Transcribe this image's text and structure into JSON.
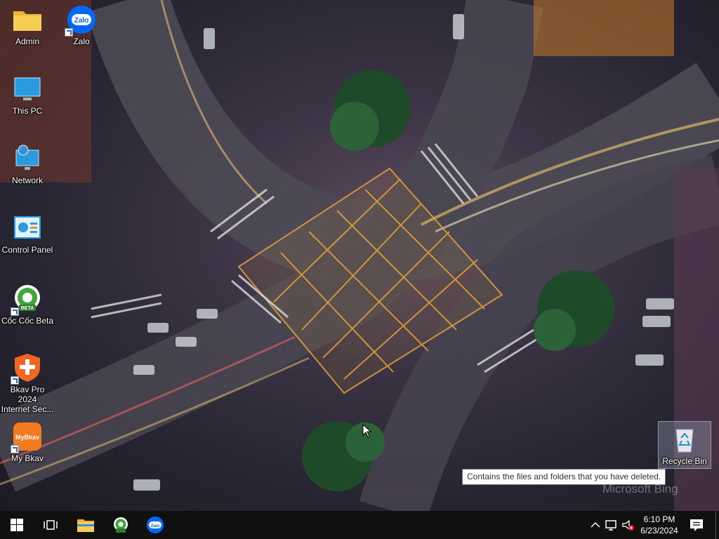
{
  "desktop": {
    "icons": [
      {
        "label": "Admin"
      },
      {
        "label": "Zalo"
      },
      {
        "label": "This PC"
      },
      {
        "label": "Network"
      },
      {
        "label": "Control Panel"
      },
      {
        "label": "Cốc Cốc Beta"
      },
      {
        "label": "Bkav Pro 2024\nInternet Sec..."
      },
      {
        "label": "My Bkav"
      },
      {
        "label": "Recycle Bin"
      }
    ],
    "tooltip": "Contains the files and folders that you have deleted.",
    "watermark": "Microsoft Bing"
  },
  "taskbar": {
    "icons": [
      "windows-start-icon",
      "task-view-icon",
      "file-explorer-icon",
      "coccoc-icon",
      "zalo-icon"
    ],
    "clock": {
      "time": "6:10 PM",
      "date": "6/23/2024"
    },
    "tray_icons": [
      "chevron-up-icon",
      "network-icon",
      "volume-muted-icon",
      "notification-icon"
    ]
  },
  "colors": {
    "taskbar_bg": "#101010",
    "crosshatch": "#e8a33a",
    "explorer_yellow": "#f2c53d",
    "zalo_blue": "#0068ff",
    "bkav_orange": "#f26522"
  }
}
